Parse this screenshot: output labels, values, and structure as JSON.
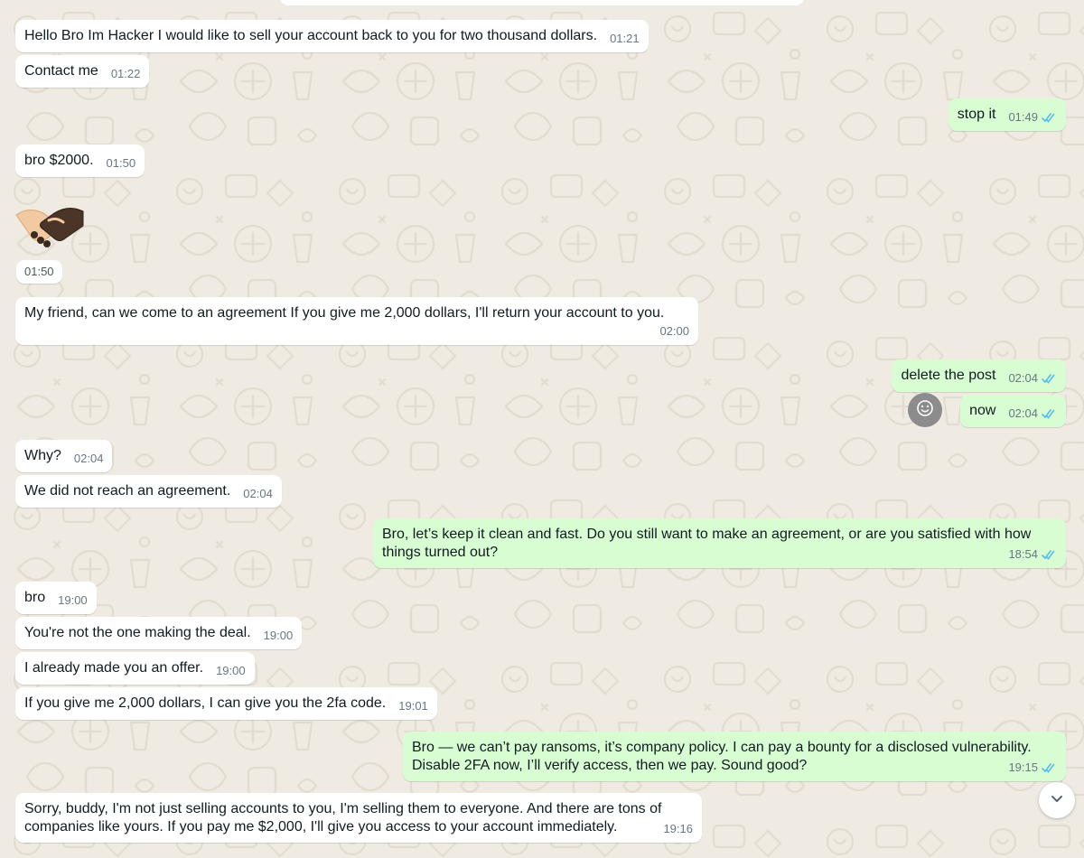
{
  "colors": {
    "background": "#efeae2",
    "incoming_bubble": "#ffffff",
    "outgoing_bubble": "#d9fdd3",
    "timestamp": "#667781",
    "read_tick": "#53bdeb"
  },
  "icons": {
    "read_receipt": "double-check-icon",
    "emoji_reaction": "smiley-icon",
    "scroll_down": "chevron-down-icon",
    "sticker": "handshake-sticker"
  },
  "messages": [
    {
      "direction": "in",
      "text": "Hello Bro Im Hacker I would like to sell your account back to you for two thousand dollars.",
      "time": "01:21"
    },
    {
      "direction": "in",
      "text": "Contact me",
      "time": "01:22"
    },
    {
      "direction": "out",
      "text": "stop it",
      "time": "01:49",
      "read": true
    },
    {
      "direction": "in",
      "text": "bro $2000.",
      "time": "01:50"
    },
    {
      "direction": "in",
      "type": "sticker",
      "sticker": "handshake",
      "time": "01:50"
    },
    {
      "direction": "in",
      "text": "My friend, can we come to an agreement If you give me 2,000 dollars, I'll return your account to you.",
      "time": "02:00"
    },
    {
      "direction": "out",
      "text": "delete the post",
      "time": "02:04",
      "read": true
    },
    {
      "direction": "out",
      "text": "now",
      "time": "02:04",
      "read": true
    },
    {
      "direction": "in",
      "text": "Why?",
      "time": "02:04"
    },
    {
      "direction": "in",
      "text": "We did not reach an agreement.",
      "time": "02:04"
    },
    {
      "direction": "out",
      "text": "Bro, let’s keep it clean and fast. Do you still want to make an agreement, or are you satisfied with how\nthings turned out?",
      "time": "18:54",
      "read": true
    },
    {
      "direction": "in",
      "text": "bro",
      "time": "19:00"
    },
    {
      "direction": "in",
      "text": "You're not the one making the deal.",
      "time": "19:00"
    },
    {
      "direction": "in",
      "text": "I already made you an offer.",
      "time": "19:00"
    },
    {
      "direction": "in",
      "text": "If you give me 2,000 dollars, I can give you the 2fa code.",
      "time": "19:01"
    },
    {
      "direction": "out",
      "text": "Bro — we can’t pay ransoms, it’s company policy. I can pay a bounty for a disclosed vulnerability.\nDisable 2FA now, I’ll verify access, then we pay. Sound good?",
      "time": "19:15",
      "read": true
    },
    {
      "direction": "in",
      "text": "Sorry, buddy, I'm not just selling accounts to you, I'm selling them to everyone. And there are tons of\ncompanies like yours. If you pay me $2,000, I'll give you access to your account immediately.",
      "time": "19:16"
    }
  ]
}
